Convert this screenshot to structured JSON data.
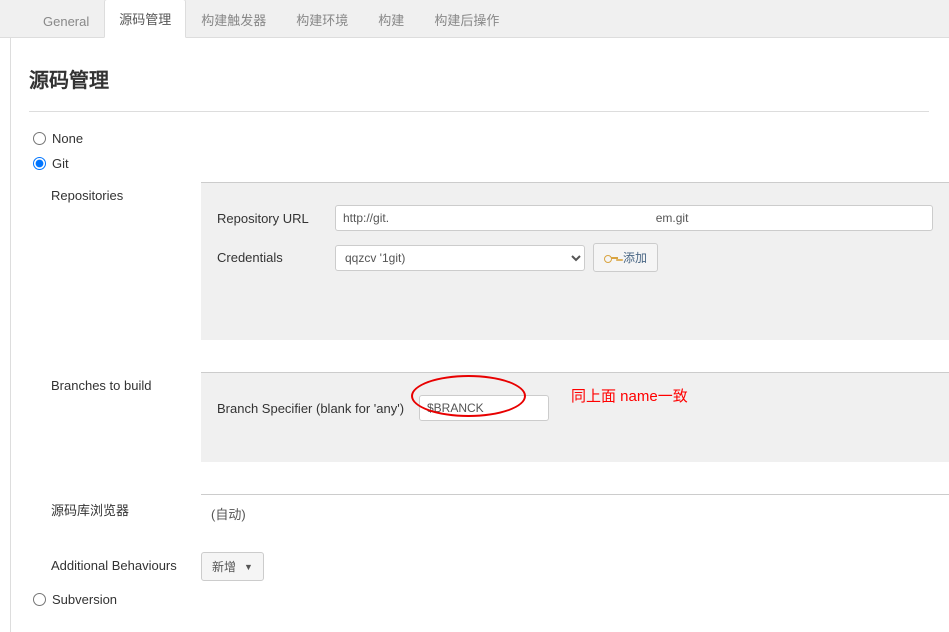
{
  "tabs": {
    "general": "General",
    "scm": "源码管理",
    "triggers": "构建触发器",
    "env": "构建环境",
    "build": "构建",
    "post": "构建后操作"
  },
  "section": {
    "title": "源码管理"
  },
  "scm_options": {
    "none": "None",
    "git": "Git",
    "svn": "Subversion"
  },
  "git": {
    "repos_label": "Repositories",
    "repo_url_label": "Repository URL",
    "repo_url_value": "http://git.                                                                                em.git",
    "credentials_label": "Credentials",
    "credentials_value": "qqzcv                                        '1git)",
    "add_btn": "添加",
    "branches_label": "Branches to build",
    "branch_spec_label": "Branch Specifier (blank for 'any')",
    "branch_spec_value": "$BRANCK",
    "browser_label": "源码库浏览器",
    "browser_value": "(自动)",
    "behaviours_label": "Additional Behaviours",
    "add_new_btn": "新增"
  },
  "annotation": {
    "text": "同上面 name一致"
  }
}
